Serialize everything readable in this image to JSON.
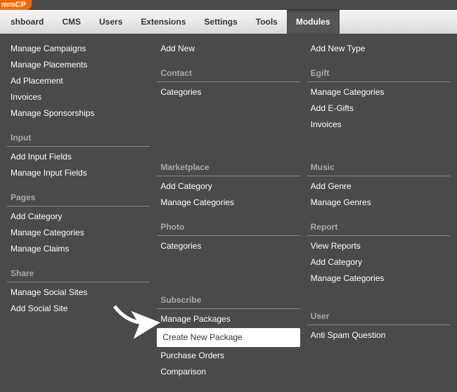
{
  "logo": "mmCP",
  "nav": [
    {
      "label": "shboard"
    },
    {
      "label": "CMS"
    },
    {
      "label": "Users"
    },
    {
      "label": "Extensions"
    },
    {
      "label": "Settings"
    },
    {
      "label": "Tools"
    },
    {
      "label": "Modules",
      "active": true
    }
  ],
  "columns": [
    {
      "sections": [
        {
          "heading": null,
          "items": [
            "Manage Campaigns",
            "Manage Placements",
            "Ad Placement",
            "Invoices",
            "Manage Sponsorships"
          ]
        },
        {
          "heading": "Input",
          "items": [
            "Add Input Fields",
            "Manage Input Fields"
          ]
        },
        {
          "heading": "Pages",
          "items": [
            "Add Category",
            "Manage Categories",
            "Manage Claims"
          ]
        },
        {
          "heading": "Share",
          "items": [
            "Manage Social Sites",
            "Add Social Site"
          ]
        }
      ]
    },
    {
      "sections": [
        {
          "heading": null,
          "items": [
            "Add New"
          ]
        },
        {
          "heading": "Contact",
          "items": [
            "Categories"
          ]
        },
        {
          "heading_spacer": 72
        },
        {
          "heading": "Marketplace",
          "items": [
            "Add Category",
            "Manage Categories"
          ]
        },
        {
          "heading": "Photo",
          "items": [
            "Categories"
          ]
        },
        {
          "heading_spacer": 42
        },
        {
          "heading": "Subscribe",
          "items": [
            "Manage Packages",
            {
              "label": "Create New Package",
              "highlighted": true
            },
            "Purchase Orders",
            "Comparison"
          ]
        }
      ]
    },
    {
      "sections": [
        {
          "heading": null,
          "items": [
            "Add New Type"
          ]
        },
        {
          "heading": "Egift",
          "items": [
            "Manage Categories",
            "Add E-Gifts",
            "Invoices"
          ]
        },
        {
          "heading_spacer": 26
        },
        {
          "heading": "Music",
          "items": [
            "Add Genre",
            "Manage Genres"
          ]
        },
        {
          "heading": "Report",
          "items": [
            "View Reports",
            "Add Category",
            "Manage Categories"
          ]
        },
        {
          "heading_spacer": 19
        },
        {
          "heading": "User",
          "items": [
            "Anti Spam Question"
          ]
        }
      ]
    }
  ]
}
